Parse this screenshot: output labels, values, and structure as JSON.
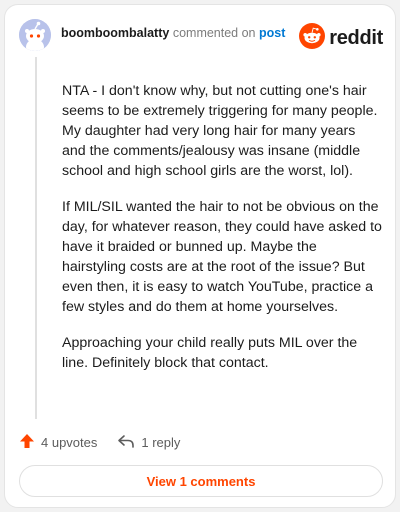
{
  "header": {
    "username": "boomboombalatty",
    "action": "commented on",
    "post_link": "post",
    "brand": "reddit"
  },
  "comment": {
    "paragraphs": [
      "NTA - I don't know why, but not cutting one's hair seems to be extremely triggering for many people. My daughter had very long hair for many years and the comments/jealousy was insane (middle school and high school girls are the worst, lol).",
      "If MIL/SIL wanted the hair to not be obvious on the day, for whatever reason, they could have asked to have it braided or bunned up. Maybe the hairstyling costs are at the root of the issue? But even then, it is easy to watch YouTube, practice a few styles and do them at home yourselves.",
      "Approaching your child really puts MIL over the line. Definitely block that contact."
    ]
  },
  "actions": {
    "upvotes": "4 upvotes",
    "reply": "1 reply"
  },
  "view_button": "View 1 comments",
  "colors": {
    "accent": "#ff4500",
    "link": "#0079d3",
    "avatar_bg": "#b8c2ea"
  },
  "icons": [
    "snoo-avatar-icon",
    "reddit-logo-icon",
    "upvote-arrow-icon",
    "reply-arrow-icon"
  ]
}
